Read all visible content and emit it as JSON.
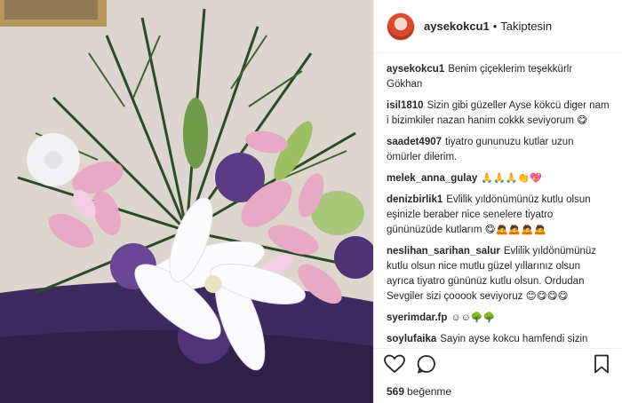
{
  "post": {
    "username": "aysekokcu1",
    "separator": "•",
    "follow_status": "Takiptesin",
    "caption_user": "aysekokcu1",
    "caption_text": "Benim çiçeklerim teşekkürlr Gökhan"
  },
  "comments": [
    {
      "user": "isil1810",
      "text": "Sizin gibi güzeller Ayse kökcü diger nam i bizimkiler nazan hanim cokkk seviyorum 😋"
    },
    {
      "user": "saadet4907",
      "text": "tiyatro gununuzu kutlar uzun ömürler dilerim."
    },
    {
      "user": "melek_anna_gulay",
      "text": "🙏🙏🙏👏💖"
    },
    {
      "user": "denizbirlik1",
      "text": "Evlilik yıldönümünüz kutlu olsun eşinizle beraber nice senelere tiyatro gününüzüde kutlarım 😋🙇🙇🙇🙇"
    },
    {
      "user": "neslihan_sarihan_salur",
      "text": "Evlilik yıldönümünüz kutlu olsun nice mutlu güzel yıllarınız olsun ayrıca tiyatro gününüz kutlu olsun. Ordudan Sevgiler sizi çooook seviyoruz 😊😋😋😋"
    },
    {
      "user": "syerimdar.fp",
      "text": "☺☺🌳🌳"
    },
    {
      "user": "soylufaika",
      "text": "Sayin ayse kokcu hamfendi sizin"
    }
  ],
  "likes": {
    "count": "569",
    "label": "beğenme"
  },
  "icons": {
    "like": "heart-icon",
    "comment": "comment-icon",
    "save": "bookmark-icon"
  }
}
